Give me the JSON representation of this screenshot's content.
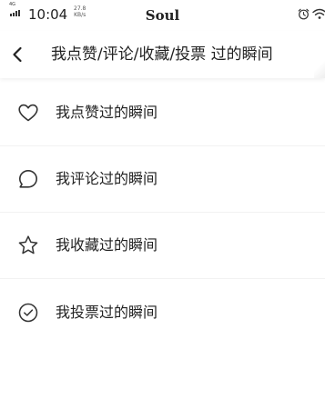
{
  "status_bar": {
    "network": "4G",
    "time": "10:04",
    "speed_value": "27.8",
    "speed_unit": "KB/s",
    "app_name": "Soul",
    "icons": [
      "signal-icon",
      "alarm-icon",
      "wifi-icon"
    ]
  },
  "header": {
    "back_icon": "back-arrow-icon",
    "title": "我点赞/评论/收藏/投票 过的瞬间"
  },
  "list": {
    "items": [
      {
        "icon": "heart-icon",
        "label": "我点赞过的瞬间"
      },
      {
        "icon": "comment-icon",
        "label": "我评论过的瞬间"
      },
      {
        "icon": "star-icon",
        "label": "我收藏过的瞬间"
      },
      {
        "icon": "check-circle-icon",
        "label": "我投票过的瞬间"
      }
    ]
  },
  "colors": {
    "text": "#222222",
    "divider": "#f2f2f2",
    "icon_stroke": "#333333",
    "background": "#ffffff"
  }
}
